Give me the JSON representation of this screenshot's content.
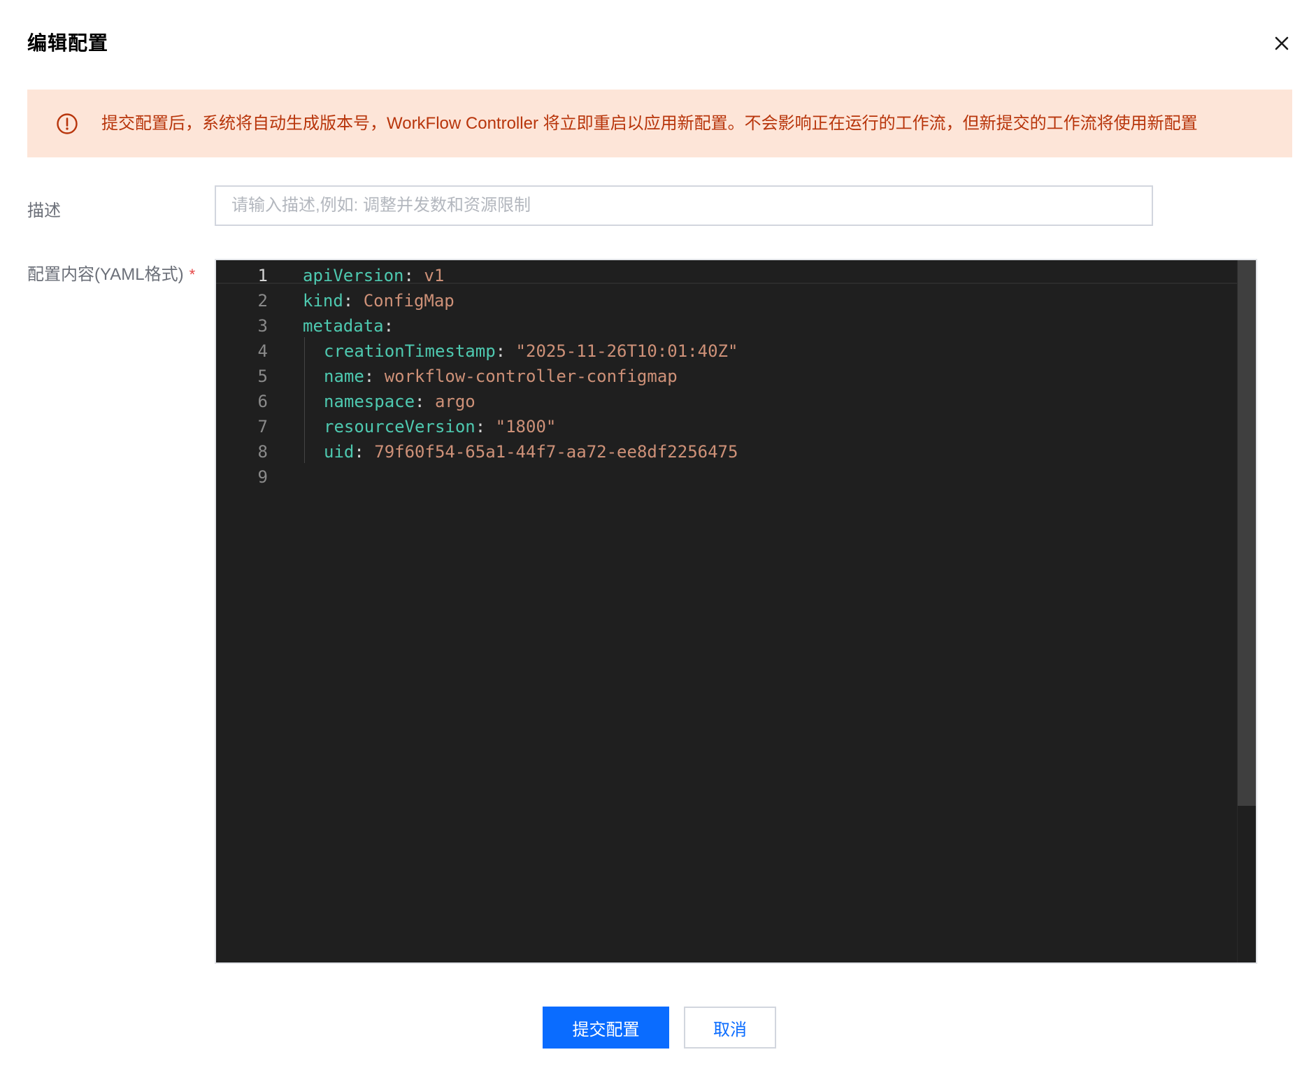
{
  "dialog": {
    "title": "编辑配置",
    "close_icon": "close-icon"
  },
  "alert": {
    "icon": "exclamation-circle-icon",
    "text": "提交配置后，系统将自动生成版本号，WorkFlow Controller 将立即重启以应用新配置。不会影响正在运行的工作流，但新提交的工作流将使用新配置",
    "background": "#fde5d8",
    "text_color": "#b8350b"
  },
  "form": {
    "description_label": "描述",
    "description_placeholder": "请输入描述,例如: 调整并发数和资源限制",
    "description_value": "",
    "yaml_label": "配置内容(YAML格式)",
    "required_mark": "*"
  },
  "editor": {
    "active_line": 1,
    "lines": [
      {
        "no": "1",
        "indent": 0,
        "key": "apiVersion",
        "sep": ":",
        "value": " v1"
      },
      {
        "no": "2",
        "indent": 0,
        "key": "kind",
        "sep": ":",
        "value": " ConfigMap"
      },
      {
        "no": "3",
        "indent": 0,
        "key": "metadata",
        "sep": ":",
        "value": ""
      },
      {
        "no": "4",
        "indent": 1,
        "key": "creationTimestamp",
        "sep": ":",
        "value": " \"2025-11-26T10:01:40Z\""
      },
      {
        "no": "5",
        "indent": 1,
        "key": "name",
        "sep": ":",
        "value": " workflow-controller-configmap"
      },
      {
        "no": "6",
        "indent": 1,
        "key": "namespace",
        "sep": ":",
        "value": " argo"
      },
      {
        "no": "7",
        "indent": 1,
        "key": "resourceVersion",
        "sep": ":",
        "value": " \"1800\""
      },
      {
        "no": "8",
        "indent": 1,
        "key": "uid",
        "sep": ":",
        "value": " 79f60f54-65a1-44f7-aa72-ee8df2256475"
      },
      {
        "no": "9",
        "indent": 0,
        "key": "",
        "sep": "",
        "value": ""
      }
    ],
    "colors": {
      "background": "#1f1f1f",
      "key": "#4ec9b0",
      "value": "#ce9178"
    }
  },
  "footer": {
    "submit_label": "提交配置",
    "cancel_label": "取消",
    "primary_color": "#0a6cff"
  }
}
